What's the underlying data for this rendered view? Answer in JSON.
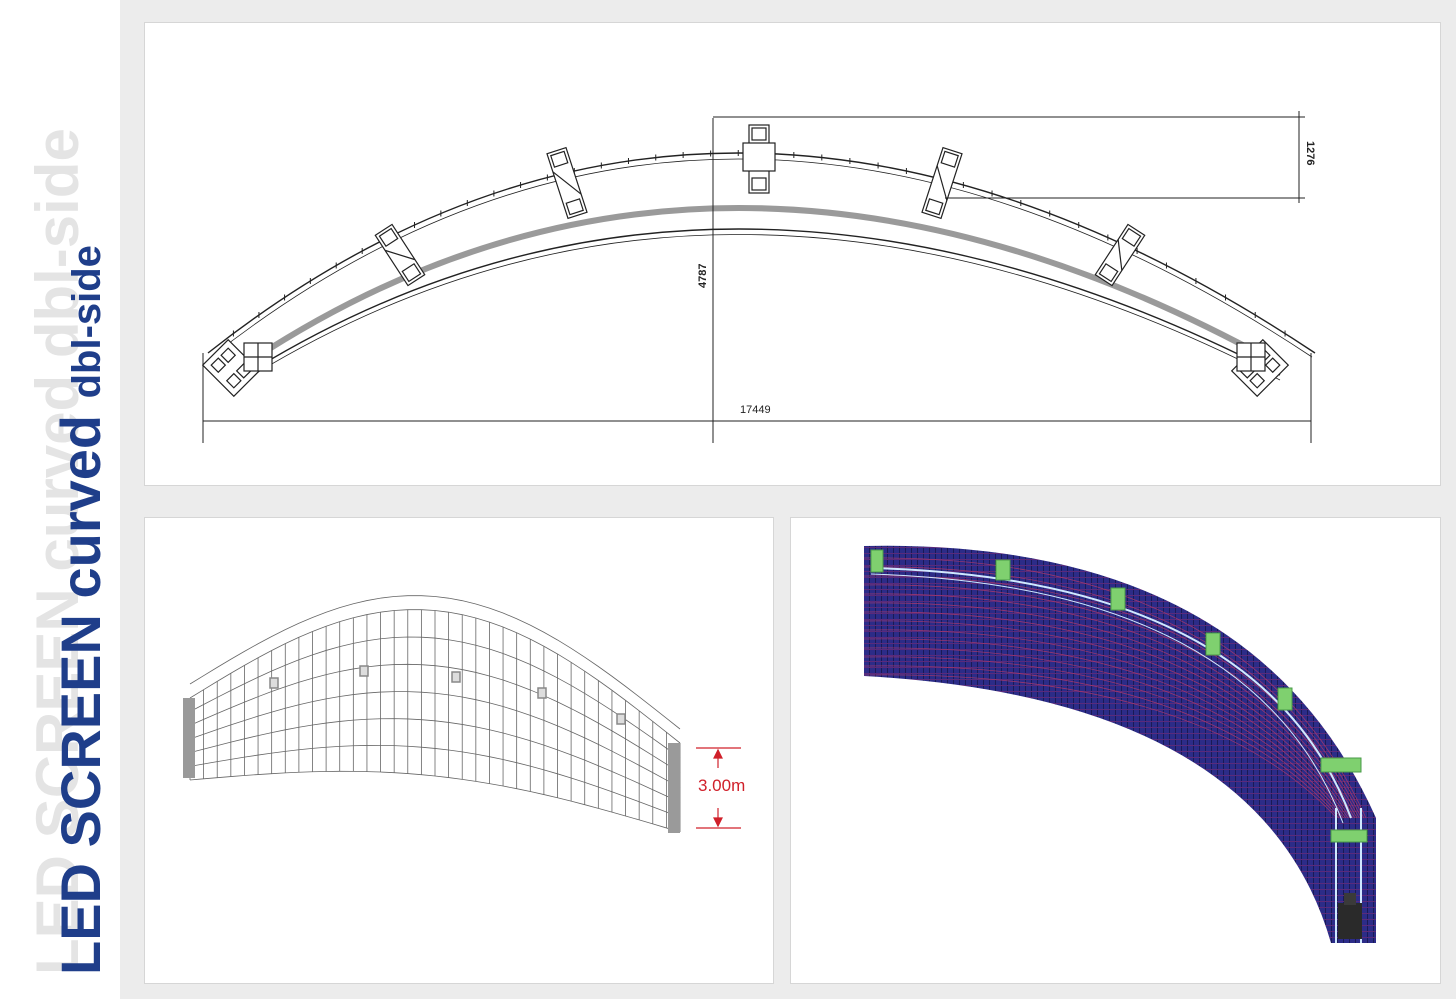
{
  "title": {
    "main": "LED SCREEN curved",
    "side": "dbl-side",
    "shadow": "LED SCREEN curved dbl-side"
  },
  "top_drawing": {
    "width_dim": "17449",
    "rise_dim": "4787",
    "depth_dim": "1276"
  },
  "bottom_left": {
    "height_dim": "3.00m"
  },
  "colors": {
    "title_blue": "#1f3e8a",
    "shadow_gray": "#e2e2e2",
    "dim_red": "#d0202a",
    "led_blue": "#2c2c88",
    "truss_green": "#7fd06f"
  }
}
